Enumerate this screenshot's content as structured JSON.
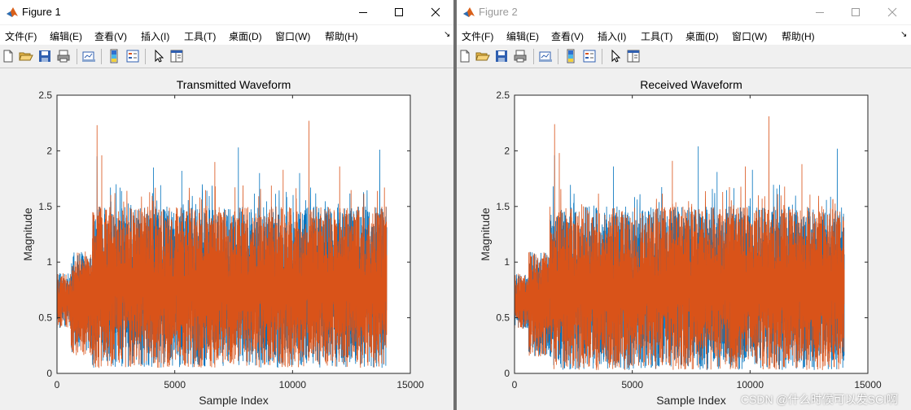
{
  "windows": [
    {
      "title": "Figure 1",
      "active": true,
      "menu": [
        "文件(F)",
        "编辑(E)",
        "查看(V)",
        "插入(I)",
        "工具(T)",
        "桌面(D)",
        "窗口(W)",
        "帮助(H)"
      ],
      "toolbar": [
        "new-figure",
        "open-file",
        "save",
        "print",
        "link-plot",
        "insert-colorbar",
        "insert-legend",
        "edit-plot",
        "property-inspector"
      ]
    },
    {
      "title": "Figure 2",
      "active": false,
      "menu": [
        "文件(F)",
        "编辑(E)",
        "查看(V)",
        "插入(I)",
        "工具(T)",
        "桌面(D)",
        "窗口(W)",
        "帮助(H)"
      ],
      "toolbar": [
        "new-figure",
        "open-file",
        "save",
        "print",
        "link-plot",
        "insert-colorbar",
        "insert-legend",
        "edit-plot",
        "property-inspector"
      ]
    }
  ],
  "chart_data": [
    {
      "type": "line",
      "title": "Transmitted Waveform",
      "xlabel": "Sample Index",
      "ylabel": "Magnitude",
      "xlim": [
        0,
        15000
      ],
      "ylim": [
        0,
        2.5
      ],
      "xticks": [
        "0",
        "5000",
        "10000",
        "15000"
      ],
      "yticks": [
        "0",
        "0.5",
        "1",
        "1.5",
        "2",
        "2.5"
      ],
      "grid": false,
      "series": [
        {
          "color": "#0072BD",
          "x_end": 14000,
          "band": [
            0.05,
            1.5
          ],
          "peak_max": 2.03,
          "peaks": [
            [
              1700,
              1.95
            ],
            [
              4100,
              1.85
            ],
            [
              5300,
              1.82
            ],
            [
              7700,
              2.03
            ],
            [
              8600,
              1.8
            ],
            [
              10300,
              1.8
            ],
            [
              13700,
              2.01
            ]
          ]
        },
        {
          "color": "#D95319",
          "x_end": 14000,
          "band": [
            0.05,
            1.5
          ],
          "peak_max": 2.27,
          "peaks": [
            [
              1700,
              2.23
            ],
            [
              1900,
              1.96
            ],
            [
              6700,
              1.9
            ],
            [
              9600,
              1.83
            ],
            [
              10700,
              2.27
            ],
            [
              12000,
              1.86
            ],
            [
              13900,
              1.67
            ]
          ]
        }
      ]
    },
    {
      "type": "line",
      "title": "Received Waveform",
      "xlabel": "Sample Index",
      "ylabel": "Magnitude",
      "xlim": [
        0,
        15000
      ],
      "ylim": [
        0,
        2.5
      ],
      "xticks": [
        "0",
        "5000",
        "10000",
        "15000"
      ],
      "yticks": [
        "0",
        "0.5",
        "1",
        "1.5",
        "2",
        "2.5"
      ],
      "grid": false,
      "series": [
        {
          "color": "#0072BD",
          "x_end": 14000,
          "band": [
            0.03,
            1.5
          ],
          "peak_max": 2.04,
          "peaks": [
            [
              1700,
              1.96
            ],
            [
              4200,
              1.86
            ],
            [
              7800,
              2.04
            ],
            [
              8600,
              1.81
            ],
            [
              10100,
              1.83
            ],
            [
              13700,
              2.02
            ]
          ]
        },
        {
          "color": "#D95319",
          "x_end": 14000,
          "band": [
            0.03,
            1.5
          ],
          "peak_max": 2.31,
          "peaks": [
            [
              1700,
              2.24
            ],
            [
              1900,
              1.98
            ],
            [
              6700,
              1.91
            ],
            [
              9800,
              1.86
            ],
            [
              10800,
              2.31
            ],
            [
              12200,
              1.88
            ]
          ]
        }
      ]
    }
  ],
  "watermark": "CSDN @什么时候可以发SCI啊",
  "colors": {
    "blue": "#0072BD",
    "orange": "#D95319",
    "plot_bg": "#ffffff",
    "figure_bg": "#f0f0f0"
  }
}
